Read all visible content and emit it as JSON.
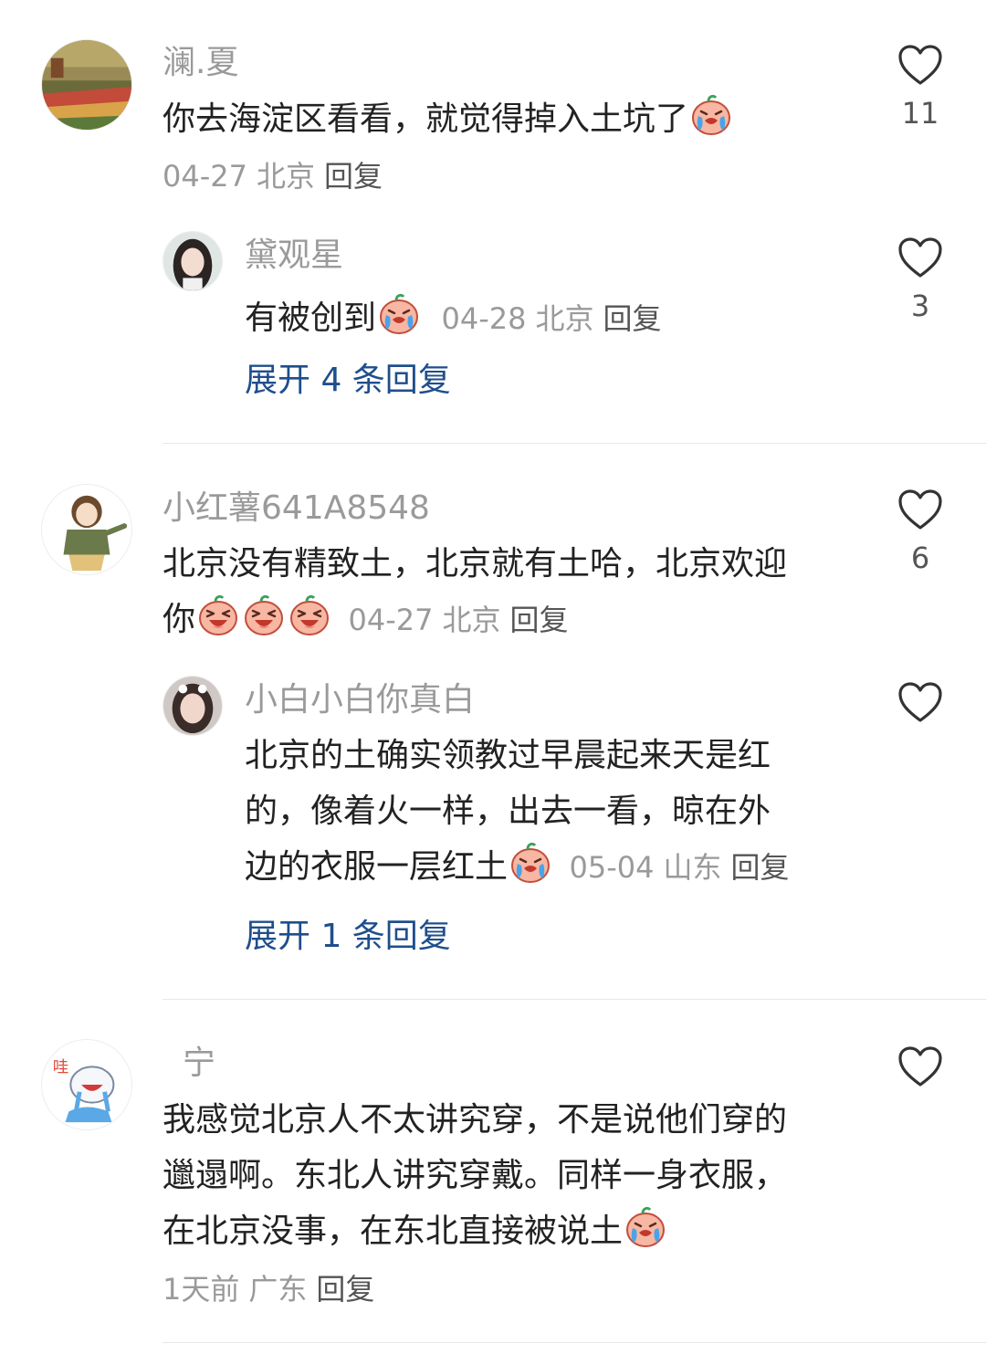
{
  "comments": [
    {
      "username": "澜.夏",
      "text": "你去海淀区看看，就觉得掉入土坑了",
      "date": "04-27",
      "location": "北京",
      "reply_label": "回复",
      "likes": "11",
      "avatar_icon": "landscape-avatar",
      "emoji_icon": "crying-face-emoji",
      "replies": [
        {
          "username": "黛观星",
          "text": "有被创到",
          "date": "04-28",
          "location": "北京",
          "reply_label": "回复",
          "likes": "3",
          "avatar_icon": "girl-photo-avatar",
          "emoji_icon": "crying-face-emoji"
        }
      ],
      "expand_label": "展开 4 条回复"
    },
    {
      "username": "小红薯641A8548",
      "text_line1": "北京没有精致土，北京就有土哈，北京欢迎",
      "text_line2": "你",
      "date": "04-27",
      "location": "北京",
      "reply_label": "回复",
      "likes": "6",
      "avatar_icon": "cartoon-girl-avatar",
      "emoji_icon": "laughing-face-emoji",
      "replies": [
        {
          "username": "小白小白你真白",
          "text_line1": "北京的土确实领教过早晨起来天是红",
          "text_line2": "的，像着火一样，出去一看，晾在外",
          "text_line3": "边的衣服一层红土",
          "date": "05-04",
          "location": "山东",
          "reply_label": "回复",
          "likes": "",
          "avatar_icon": "girl-photo-avatar",
          "emoji_icon": "crying-face-emoji"
        }
      ],
      "expand_label": "展开 1 条回复"
    },
    {
      "username": "宁",
      "text_line1": "我感觉北京人不太讲究穿，不是说他们穿的",
      "text_line2": "邋遢啊。东北人讲究穿戴。同样一身衣服，",
      "text_line3": "在北京没事，在东北直接被说土",
      "date": "1天前",
      "location": "广东",
      "reply_label": "回复",
      "likes": "",
      "avatar_icon": "crying-cartoon-avatar",
      "avatar_text": "哇",
      "emoji_icon": "crying-face-emoji"
    }
  ],
  "colors": {
    "username": "#9a9a9a",
    "content": "#222222",
    "expand_link": "#1f4e8c",
    "divider": "#e8e8e8"
  }
}
